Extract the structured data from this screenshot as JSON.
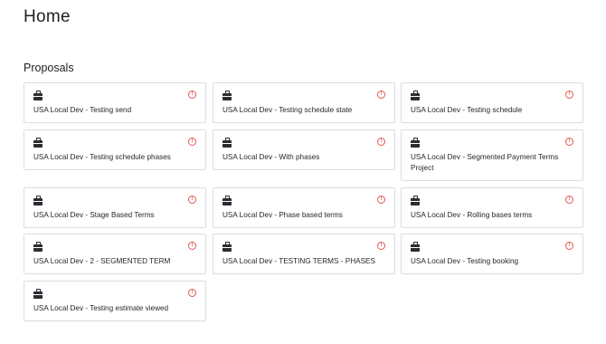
{
  "page": {
    "title": "Home"
  },
  "proposals": {
    "heading": "Proposals",
    "alert_glyph": "!",
    "icons": {
      "card": "briefcase-icon",
      "status": "alert-circle-icon"
    },
    "colors": {
      "alert": "#e0584f",
      "border": "#dadde2"
    },
    "items": [
      {
        "title": "USA Local Dev - Testing send"
      },
      {
        "title": "USA Local Dev - Testing schedule state"
      },
      {
        "title": "USA Local Dev - Testing schedule"
      },
      {
        "title": "USA Local Dev - Testing schedule phases"
      },
      {
        "title": "USA Local Dev - With phases"
      },
      {
        "title": "USA Local Dev - Segmented Payment Terms Project"
      },
      {
        "title": "USA Local Dev - Stage Based Terms"
      },
      {
        "title": "USA Local Dev - Phase based terms"
      },
      {
        "title": "USA Local Dev - Rolling bases terms"
      },
      {
        "title": "USA Local Dev - 2 - SEGMENTED TERM"
      },
      {
        "title": "USA Local Dev - TESTING TERMS - PHASES"
      },
      {
        "title": "USA Local Dev - Testing booking"
      },
      {
        "title": "USA Local Dev - Testing estimate viewed"
      }
    ]
  }
}
